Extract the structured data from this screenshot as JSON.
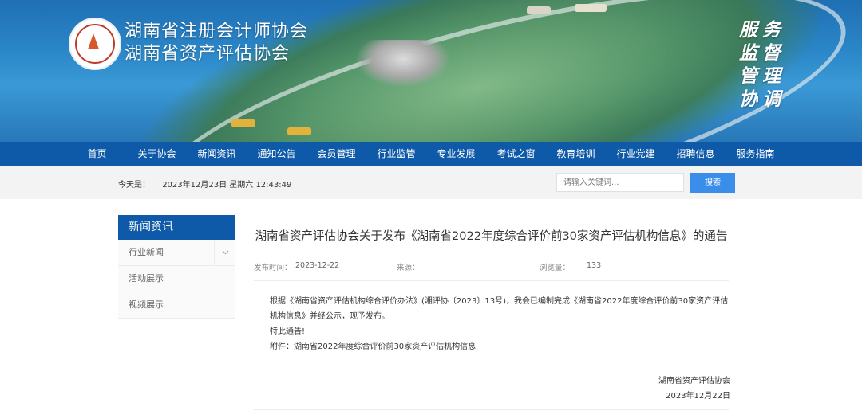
{
  "header": {
    "site_name_line1": "湖南省注册会计师协会",
    "site_name_line2": "湖南省资产评估协会",
    "slogan": [
      "服",
      "务",
      "监",
      "督",
      "管",
      "理",
      "协",
      "调"
    ]
  },
  "nav": {
    "items": [
      "首页",
      "关于协会",
      "新闻资讯",
      "通知公告",
      "会员管理",
      "行业监管",
      "专业发展",
      "考试之窗",
      "教育培训",
      "行业党建",
      "招聘信息",
      "服务指南"
    ]
  },
  "infobar": {
    "date_label": "今天是：",
    "date_value": "2023年12月23日 星期六 12:43:49",
    "search_placeholder": "请输入关键词...",
    "search_button": "搜索"
  },
  "sidebar": {
    "title": "新闻资讯",
    "items": [
      {
        "label": "行业新闻",
        "icon": "chevron-down-icon"
      },
      {
        "label": "活动展示"
      },
      {
        "label": "视频展示"
      }
    ]
  },
  "article": {
    "title": "湖南省资产评估协会关于发布《湖南省2022年度综合评价前30家资产评估机构信息》的通告",
    "publish_label": "发布时间：",
    "publish_date": "2023-12-22",
    "source_label": "来源：",
    "views_label": "浏览量：",
    "views_value": "133",
    "para1": "根据《湖南省资产评估机构综合评价办法》(湘评协〔2023〕13号)，我会已编制完成《湖南省2022年度综合评价前30家资产评估机构信息》并经公示，现予发布。",
    "para2": "特此通告!",
    "attachment": "附件：湖南省2022年度综合评价前30家资产评估机构信息",
    "signer": "湖南省资产评估协会",
    "sign_date": "2023年12月22日"
  }
}
